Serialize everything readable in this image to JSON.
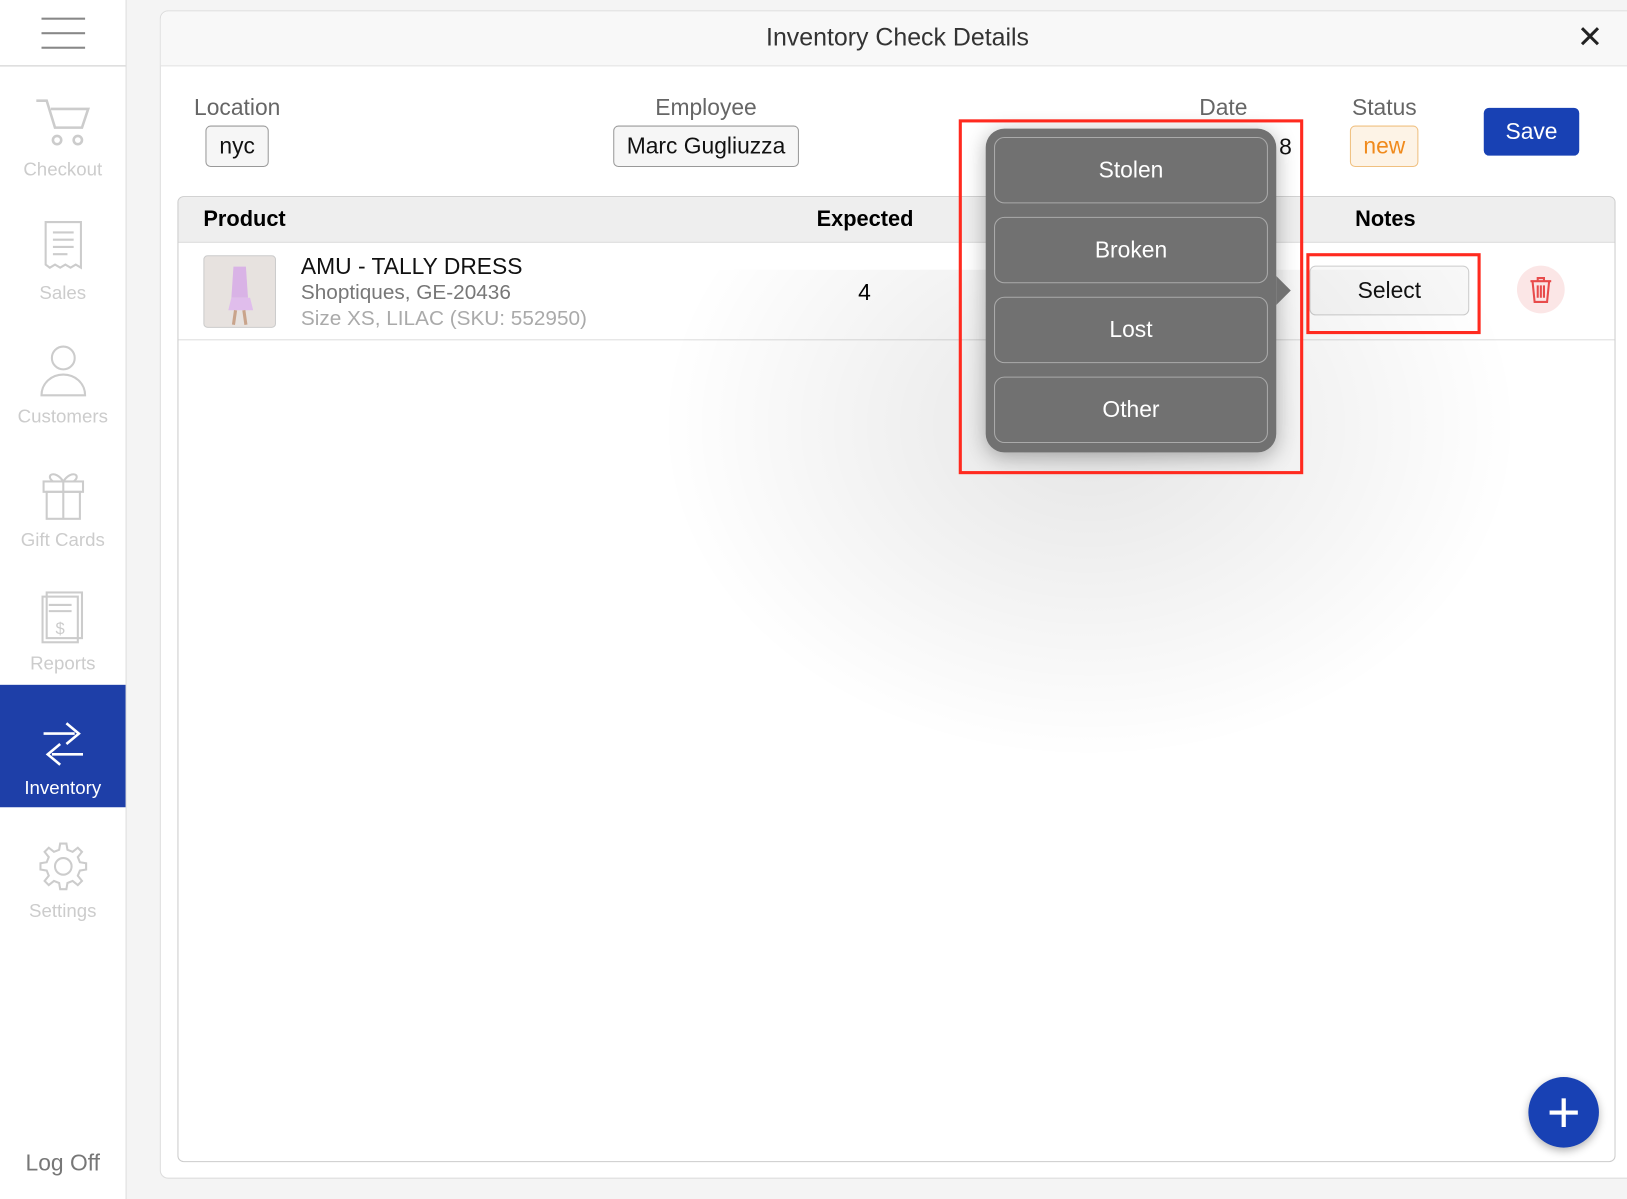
{
  "sidebar": {
    "items": [
      {
        "label": "Checkout",
        "icon": "cart-icon"
      },
      {
        "label": "Sales",
        "icon": "receipt-icon"
      },
      {
        "label": "Customers",
        "icon": "person-icon"
      },
      {
        "label": "Gift Cards",
        "icon": "gift-icon"
      },
      {
        "label": "Reports",
        "icon": "report-icon"
      },
      {
        "label": "Inventory",
        "icon": "transfer-arrows-icon",
        "active": true
      },
      {
        "label": "Settings",
        "icon": "gear-icon"
      }
    ],
    "logoff": "Log Off"
  },
  "dialog": {
    "title": "Inventory Check Details",
    "location": {
      "label": "Location",
      "value": "nyc"
    },
    "employee": {
      "label": "Employee",
      "value": "Marc Gugliuzza"
    },
    "date": {
      "label": "Date",
      "value_visible": "8"
    },
    "status": {
      "label": "Status",
      "value": "new"
    },
    "save": "Save"
  },
  "table": {
    "headers": {
      "product": "Product",
      "expected": "Expected",
      "notes": "Notes"
    },
    "rows": [
      {
        "name": "AMU - TALLY DRESS",
        "vendor": "Shoptiques, GE-20436",
        "variant": "Size XS, LILAC (SKU: 552950)",
        "expected": "4",
        "notes": "Select"
      }
    ]
  },
  "popover": {
    "options": [
      "Stolen",
      "Broken",
      "Lost",
      "Other"
    ]
  },
  "colors": {
    "accent": "#1841b4",
    "status": "#f08a1c",
    "highlight": "#ff2a1f"
  }
}
